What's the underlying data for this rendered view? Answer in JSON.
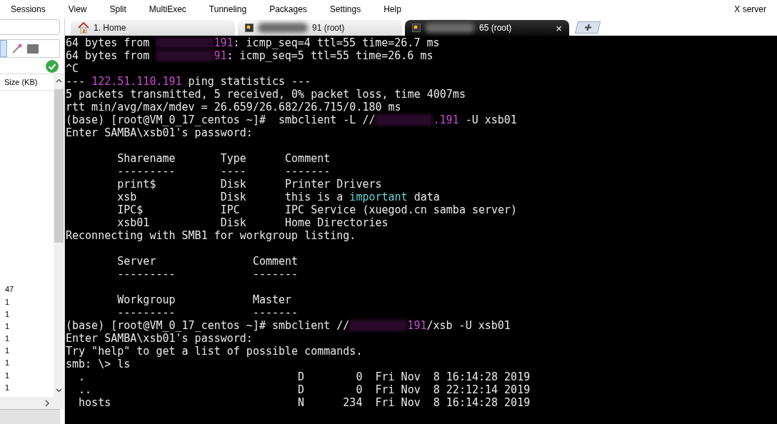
{
  "menu": [
    "Sessions",
    "View",
    "Split",
    "MultiExec",
    "Tunneling",
    "Packages",
    "Settings",
    "Help",
    "X server"
  ],
  "sidebar": {
    "column": "Size (KB)",
    "values": [
      "47",
      "1",
      "1",
      "1",
      "1",
      "1",
      "1",
      "1",
      "1"
    ]
  },
  "tabs": [
    {
      "label": "1. Home",
      "kind": "home",
      "selected": false
    },
    {
      "label": "91 (root)",
      "kind": "session",
      "selected": false
    },
    {
      "label": "65 (root)",
      "kind": "session",
      "selected": true,
      "close": "×"
    }
  ],
  "terminal": {
    "lines": [
      [
        {
          "t": "64 bytes from "
        },
        {
          "kind": "redacted"
        },
        {
          "t": "191",
          "color": "#d048d8"
        },
        {
          "t": ": icmp_seq=4 ttl=55 time=26.7 ms"
        }
      ],
      [
        {
          "t": "64 bytes from "
        },
        {
          "kind": "redacted"
        },
        {
          "t": "91",
          "color": "#d048d8"
        },
        {
          "t": ": icmp_seq=5 ttl=55 time=26.6 ms"
        }
      ],
      [
        {
          "t": "^C"
        }
      ],
      [
        {
          "t": "--- "
        },
        {
          "t": "122.51.110.191",
          "color": "#d048d8"
        },
        {
          "t": " ping statistics ---"
        }
      ],
      [
        {
          "t": "5 packets transmitted, 5 received, 0% packet loss, time 4007ms"
        }
      ],
      [
        {
          "t": "rtt min/avg/max/mdev = 26.659/26.682/26.715/0.180 ms"
        }
      ],
      [
        {
          "t": "(base) [root@VM_0_17_centos ~]#  smbclient -L //"
        },
        {
          "kind": "redacted"
        },
        {
          "t": ".191",
          "color": "#d048d8"
        },
        {
          "t": " -U xsb01"
        }
      ],
      [
        {
          "t": "Enter SAMBA\\xsb01's password:"
        }
      ],
      [
        {
          "kind": "blank"
        }
      ],
      [
        {
          "t": "        Sharename       Type      Comment"
        }
      ],
      [
        {
          "t": "        ---------       ----      -------"
        }
      ],
      [
        {
          "t": "        print$          Disk      Printer Drivers"
        }
      ],
      [
        {
          "t": "        xsb             Disk      this is a "
        },
        {
          "t": "important",
          "color": "#5fd7d7"
        },
        {
          "t": " data"
        }
      ],
      [
        {
          "t": "        IPC$            IPC       IPC Service (xuegod.cn samba server)"
        }
      ],
      [
        {
          "t": "        xsb01           Disk      Home Directories"
        }
      ],
      [
        {
          "t": "Reconnecting with SMB1 for workgroup listing."
        }
      ],
      [
        {
          "kind": "blank"
        }
      ],
      [
        {
          "t": "        Server               Comment"
        }
      ],
      [
        {
          "t": "        ---------            -------"
        }
      ],
      [
        {
          "kind": "blank"
        }
      ],
      [
        {
          "t": "        Workgroup            Master"
        }
      ],
      [
        {
          "t": "        ---------            -------"
        }
      ],
      [
        {
          "t": "(base) [root@VM_0_17_centos ~]# smbclient //"
        },
        {
          "kind": "redacted"
        },
        {
          "t": "191",
          "color": "#d048d8"
        },
        {
          "t": "/xsb -U xsb01"
        }
      ],
      [
        {
          "t": "Enter SAMBA\\xsb01's password:"
        }
      ],
      [
        {
          "t": "Try \"help\" to get a list of possible commands."
        }
      ],
      [
        {
          "t": "smb: \\> ls"
        }
      ],
      [
        {
          "t": "  .                                 D        0  Fri Nov  8 16:14:28 2019"
        }
      ],
      [
        {
          "t": "  ..                                D        0  Fri Nov  8 22:12:14 2019"
        }
      ],
      [
        {
          "t": "  hosts                             N      234  Fri Nov  8 16:14:28 2019"
        }
      ]
    ]
  }
}
